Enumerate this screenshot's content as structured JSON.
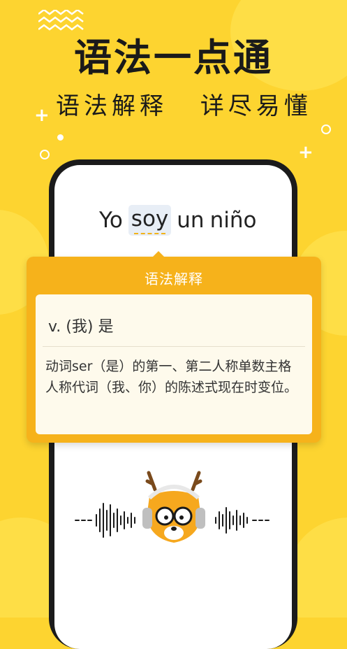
{
  "promo": {
    "headline": "语法一点通",
    "subheadline_left": "语法解释",
    "subheadline_right": "详尽易懂"
  },
  "sentence": {
    "words": [
      "Yo",
      "soy",
      "un",
      "niño"
    ],
    "highlighted_word": "soy"
  },
  "grammar_popup": {
    "title": "语法解释",
    "part_of_speech": "v. (我) 是",
    "definition": "动词ser（是）的第一、第二人称单数主格人称代词（我、你）的陈述式现在时变位。"
  },
  "audio_mascot": {
    "icon": "deer-mascot-with-headphones-icon",
    "waveform_icon": "audio-waveform-icon"
  },
  "colors": {
    "background": "#FDD430",
    "popup_accent": "#F6B21B",
    "popup_card": "#FEFAEC",
    "highlight_bg": "#E8EEF6",
    "underline": "#F2B21A"
  }
}
